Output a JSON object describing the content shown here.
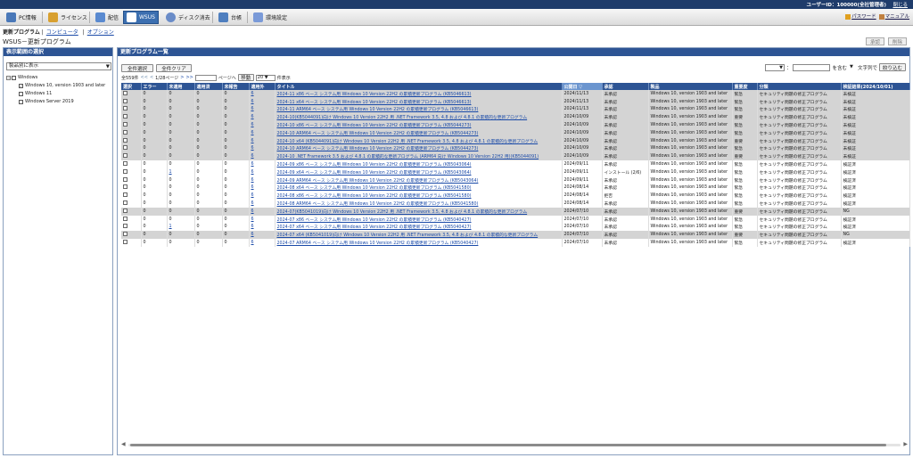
{
  "topbar": {
    "user": "ユーザーID：100000(全社管理者)",
    "logout": "閉じる"
  },
  "menu": {
    "tabs": [
      {
        "label": "PC情報",
        "icon": "pc-icon",
        "color": "#4a78b8"
      },
      {
        "label": "ライセンス",
        "icon": "license-icon",
        "color": "#d8a030"
      },
      {
        "label": "配信",
        "icon": "delivery-icon",
        "color": "#5a8ad0"
      },
      {
        "label": "WSUS",
        "icon": "wsus-icon",
        "color": "#ffffff"
      },
      {
        "label": "ディスク消去",
        "icon": "disk-erase-icon",
        "color": "#6a8cc8"
      },
      {
        "label": "台帳",
        "icon": "ledger-icon",
        "color": "#4f7fbf"
      },
      {
        "label": "環境設定",
        "icon": "settings-icon",
        "color": "#7a9ad8"
      }
    ],
    "password": "パスワード",
    "manual": "マニュアル"
  },
  "subnav": {
    "current": "更新プログラム",
    "links": [
      "コンピュータ",
      "オプション"
    ]
  },
  "page_title": "WSUS－更新プログラム",
  "page_buttons": {
    "approve": "承認",
    "delete": "削除"
  },
  "left": {
    "head": "表示範囲の選択",
    "filter": "製品別に表示",
    "tree": {
      "root": "Windows",
      "children": [
        {
          "label": "Windows 10, version 1903 and later",
          "checked": true
        },
        {
          "label": "Windows 11",
          "checked": false
        },
        {
          "label": "Windows Server 2019",
          "checked": false
        }
      ]
    }
  },
  "right": {
    "head": "更新プログラム一覧",
    "select_all": "全件選択",
    "clear_all": "全件クリア",
    "total": "全559件",
    "pager": {
      "first": "<<",
      "prev": "<",
      "page": "1/28ページ",
      "next": ">",
      "last": ">>",
      "goto_suffix": "ページへ",
      "move": "移動",
      "per_page": "20",
      "per_page_suffix": "件表示"
    },
    "search": {
      "colon": "：",
      "include": "を含む",
      "hint": "文字列で",
      "button": "絞り込む"
    },
    "columns": [
      "選択",
      "エラー",
      "未適用",
      "適用済",
      "未報告",
      "適用外",
      "タイトル",
      "公開日 ▽",
      "承認",
      "製品",
      "重要度",
      "分類",
      "検証結果(2024/10/01)"
    ],
    "rows": [
      {
        "e": "0",
        "u": "0",
        "a": "0",
        "r": "0",
        "n": "6",
        "t": "2024-11 x86 ベース システム用 Windows 10 Version 22H2 の累積更新プログラム (KB5046613)",
        "d": "2024/11/13",
        "ap": "未承認",
        "p": "Windows 10, version 1903 and later",
        "s": "緊急",
        "c": "セキュリティ問題の修正プログラム",
        "v": "未検証",
        "g": true
      },
      {
        "e": "0",
        "u": "0",
        "a": "0",
        "r": "0",
        "n": "6",
        "t": "2024-11 x64 ベース システム用 Windows 10 Version 22H2 の累積更新プログラム (KB5046613)",
        "d": "2024/11/13",
        "ap": "未承認",
        "p": "Windows 10, version 1903 and later",
        "s": "緊急",
        "c": "セキュリティ問題の修正プログラム",
        "v": "未検証",
        "g": true
      },
      {
        "e": "0",
        "u": "0",
        "a": "0",
        "r": "0",
        "n": "6",
        "t": "2024-11 ARM64 ベース システム用 Windows 10 Version 22H2 の累積更新プログラム (KB5046613)",
        "d": "2024/11/13",
        "ap": "未承認",
        "p": "Windows 10, version 1903 and later",
        "s": "緊急",
        "c": "セキュリティ問題の修正プログラム",
        "v": "未検証",
        "g": true
      },
      {
        "e": "0",
        "u": "0",
        "a": "0",
        "r": "0",
        "n": "6",
        "t": "2024-10(KB5044091)向け Windows 10 Version 22H2 用 .NET Framework 3.5, 4.8 および 4.8.1 の累積的な更新プログラム",
        "d": "2024/10/09",
        "ap": "未承認",
        "p": "Windows 10, version 1903 and later",
        "s": "重要",
        "c": "セキュリティ問題の修正プログラム",
        "v": "未検証",
        "g": true
      },
      {
        "e": "0",
        "u": "0",
        "a": "0",
        "r": "0",
        "n": "6",
        "t": "2024-10 x86 ベース システム用 Windows 10 Version 22H2 の累積更新プログラム (KB5044273)",
        "d": "2024/10/09",
        "ap": "未承認",
        "p": "Windows 10, version 1903 and later",
        "s": "緊急",
        "c": "セキュリティ問題の修正プログラム",
        "v": "未検証",
        "g": true
      },
      {
        "e": "0",
        "u": "0",
        "a": "0",
        "r": "0",
        "n": "6",
        "t": "2024-10 ARM64 ベース システム用 Windows 10 Version 22H2 の累積更新プログラム (KB5044273)",
        "d": "2024/10/09",
        "ap": "未承認",
        "p": "Windows 10, version 1903 and later",
        "s": "緊急",
        "c": "セキュリティ問題の修正プログラム",
        "v": "未検証",
        "g": true
      },
      {
        "e": "0",
        "u": "0",
        "a": "0",
        "r": "0",
        "n": "6",
        "t": "2024-10 x64 (KB5044091)向け Windows 10 Version 22H2 用 .NET Framework 3.5, 4.8 および 4.8.1 の累積的な更新プログラム",
        "d": "2024/10/09",
        "ap": "未承認",
        "p": "Windows 10, version 1903 and later",
        "s": "重要",
        "c": "セキュリティ問題の修正プログラム",
        "v": "未検証",
        "g": true
      },
      {
        "e": "0",
        "u": "0",
        "a": "0",
        "r": "0",
        "n": "6",
        "t": "2024-10 ARM64 ベース システム用 Windows 10 Version 22H2 の累積更新プログラム (KB5044273)",
        "d": "2024/10/09",
        "ap": "未承認",
        "p": "Windows 10, version 1903 and later",
        "s": "緊急",
        "c": "セキュリティ問題の修正プログラム",
        "v": "未検証",
        "g": true
      },
      {
        "e": "0",
        "u": "0",
        "a": "0",
        "r": "0",
        "n": "6",
        "t": "2024-10 .NET Framework 3.5 および 4.8.1 の累積的な更新プログラム (ARM64 向け Windows 10 Version 22H2 用)(KB5044091)",
        "d": "2024/10/09",
        "ap": "未承認",
        "p": "Windows 10, version 1903 and later",
        "s": "重要",
        "c": "セキュリティ問題の修正プログラム",
        "v": "未検証",
        "g": true
      },
      {
        "e": "0",
        "u": "0",
        "a": "0",
        "r": "0",
        "n": "6",
        "t": "2024-09 x86 ベース システム用 Windows 10 Version 22H2 の累積更新プログラム (KB5043064)",
        "d": "2024/09/11",
        "ap": "未承認",
        "p": "Windows 10, version 1903 and later",
        "s": "緊急",
        "c": "セキュリティ問題の修正プログラム",
        "v": "検証済",
        "g": false
      },
      {
        "e": "0",
        "u": "1",
        "a": "0",
        "r": "0",
        "n": "6",
        "t": "2024-09 x64 ベース システム用 Windows 10 Version 22H2 の累積更新プログラム (KB5043064)",
        "d": "2024/09/11",
        "ap": "インストール (2/6)",
        "p": "Windows 10, version 1903 and later",
        "s": "緊急",
        "c": "セキュリティ問題の修正プログラム",
        "v": "検証済",
        "g": false
      },
      {
        "e": "0",
        "u": "0",
        "a": "0",
        "r": "0",
        "n": "6",
        "t": "2024-09 ARM64 ベース システム用 Windows 10 Version 22H2 の累積更新プログラム (KB5043064)",
        "d": "2024/09/11",
        "ap": "未承認",
        "p": "Windows 10, version 1903 and later",
        "s": "緊急",
        "c": "セキュリティ問題の修正プログラム",
        "v": "検証済",
        "g": false
      },
      {
        "e": "0",
        "u": "0",
        "a": "0",
        "r": "0",
        "n": "6",
        "t": "2024-08 x64 ベース システム用 Windows 10 Version 22H2 の累積更新プログラム (KB5041580)",
        "d": "2024/08/14",
        "ap": "未承認",
        "p": "Windows 10, version 1903 and later",
        "s": "緊急",
        "c": "セキュリティ問題の修正プログラム",
        "v": "検証済",
        "g": false
      },
      {
        "e": "0",
        "u": "0",
        "a": "0",
        "r": "0",
        "n": "6",
        "t": "2024-08 x86 ベース システム用 Windows 10 Version 22H2 の累積更新プログラム (KB5041580)",
        "d": "2024/08/14",
        "ap": "拒否",
        "p": "Windows 10, version 1903 and later",
        "s": "緊急",
        "c": "セキュリティ問題の修正プログラム",
        "v": "検証済",
        "g": false
      },
      {
        "e": "0",
        "u": "0",
        "a": "0",
        "r": "0",
        "n": "6",
        "t": "2024-08 ARM64 ベース システム用 Windows 10 Version 22H2 の累積更新プログラム (KB5041580)",
        "d": "2024/08/14",
        "ap": "未承認",
        "p": "Windows 10, version 1903 and later",
        "s": "緊急",
        "c": "セキュリティ問題の修正プログラム",
        "v": "検証済",
        "g": false
      },
      {
        "e": "0",
        "u": "0",
        "a": "0",
        "r": "0",
        "n": "6",
        "t": "2024-07(KB5041019)向け Windows 10 Version 22H2 用 .NET Framework 3.5, 4.8 および 4.8.1 の累積的な更新プログラム",
        "d": "2024/07/10",
        "ap": "未承認",
        "p": "Windows 10, version 1903 and later",
        "s": "重要",
        "c": "セキュリティ問題の修正プログラム",
        "v": "NG",
        "g": true
      },
      {
        "e": "0",
        "u": "0",
        "a": "0",
        "r": "0",
        "n": "6",
        "t": "2024-07 x86 ベース システム用 Windows 10 Version 22H2 の累積更新プログラム (KB5040427)",
        "d": "2024/07/10",
        "ap": "未承認",
        "p": "Windows 10, version 1903 and later",
        "s": "緊急",
        "c": "セキュリティ問題の修正プログラム",
        "v": "検証済",
        "g": false
      },
      {
        "e": "0",
        "u": "1",
        "a": "0",
        "r": "0",
        "n": "6",
        "t": "2024-07 x64 ベース システム用 Windows 10 Version 22H2 の累積更新プログラム (KB5040427)",
        "d": "2024/07/10",
        "ap": "未承認",
        "p": "Windows 10, version 1903 and later",
        "s": "緊急",
        "c": "セキュリティ問題の修正プログラム",
        "v": "検証済",
        "g": false
      },
      {
        "e": "0",
        "u": "0",
        "a": "0",
        "r": "0",
        "n": "6",
        "t": "2024-07 x64 (KB5041019)向け Windows 10 Version 22H2 用 .NET Framework 3.5, 4.8 および 4.8.1 の累積的な更新プログラム",
        "d": "2024/07/10",
        "ap": "未承認",
        "p": "Windows 10, version 1903 and later",
        "s": "重要",
        "c": "セキュリティ問題の修正プログラム",
        "v": "NG",
        "g": true
      },
      {
        "e": "0",
        "u": "0",
        "a": "0",
        "r": "0",
        "n": "6",
        "t": "2024-07 ARM64 ベース システム用 Windows 10 Version 22H2 の累積更新プログラム (KB5040427)",
        "d": "2024/07/10",
        "ap": "未承認",
        "p": "Windows 10, version 1903 and later",
        "s": "緊急",
        "c": "セキュリティ問題の修正プログラム",
        "v": "検証済",
        "g": false
      }
    ]
  }
}
